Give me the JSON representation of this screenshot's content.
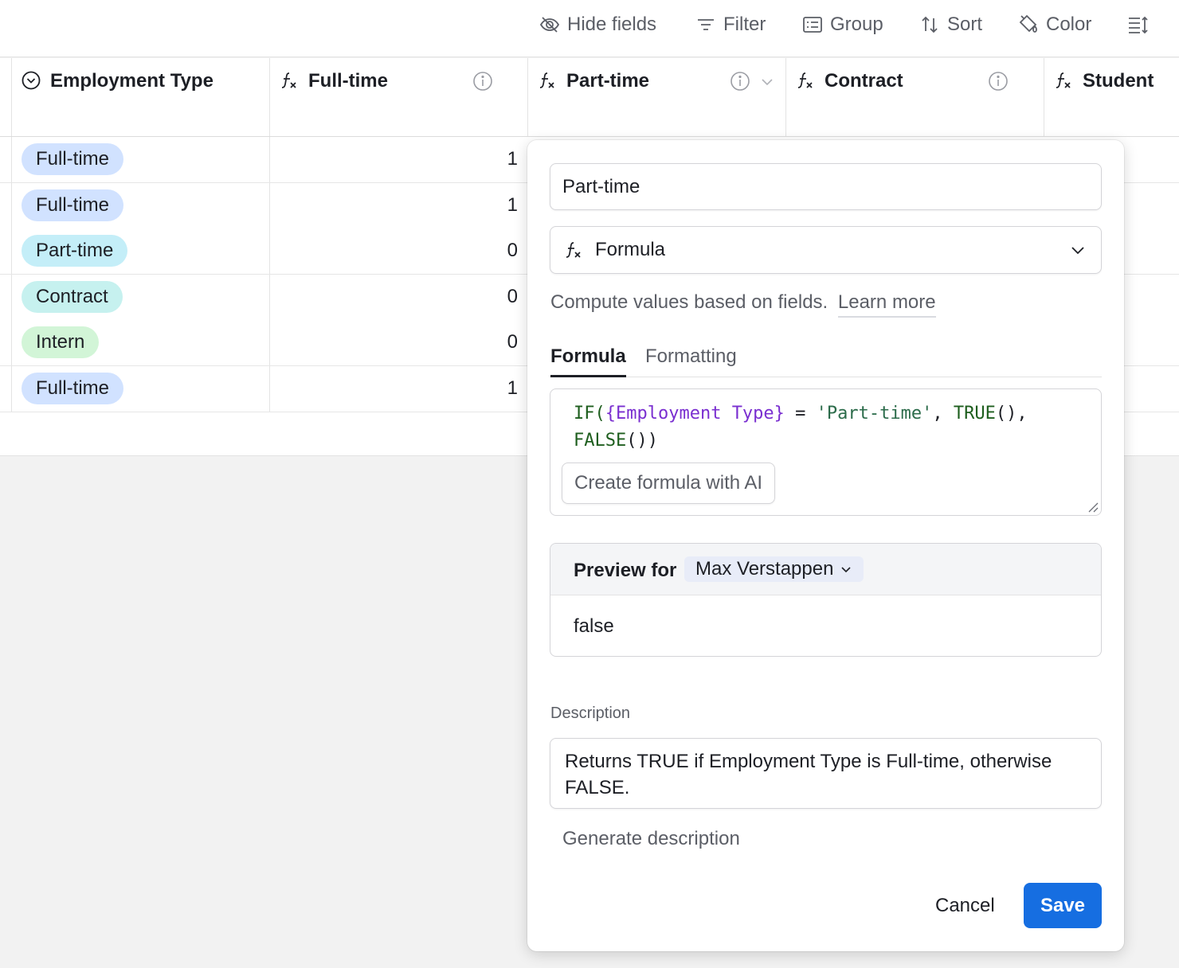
{
  "toolbar": {
    "hide_fields": "Hide fields",
    "filter": "Filter",
    "group": "Group",
    "sort": "Sort",
    "color": "Color"
  },
  "columns": [
    {
      "label": "Employment Type",
      "icon": "single-select-icon"
    },
    {
      "label": "Full-time",
      "icon": "formula-icon"
    },
    {
      "label": "Part-time",
      "icon": "formula-icon"
    },
    {
      "label": "Contract",
      "icon": "formula-icon"
    },
    {
      "label": "Student",
      "icon": "formula-icon"
    }
  ],
  "rows": [
    {
      "type": "Full-time",
      "full_time": "1",
      "color": "#d1e2ff"
    },
    {
      "type": "Full-time",
      "full_time": "1",
      "color": "#d1e2ff"
    },
    {
      "type": "Part-time",
      "full_time": "0",
      "color": "#c4eef8"
    },
    {
      "type": "Contract",
      "full_time": "0",
      "color": "#c6f1ef"
    },
    {
      "type": "Intern",
      "full_time": "0",
      "color": "#d2f5d7"
    },
    {
      "type": "Full-time",
      "full_time": "1",
      "color": "#d1e2ff"
    }
  ],
  "editor": {
    "field_name": "Part-time",
    "field_type": "Formula",
    "help_text": "Compute values based on fields.",
    "learn_more": "Learn more",
    "tabs": {
      "formula": "Formula",
      "formatting": "Formatting"
    },
    "formula": {
      "line1": {
        "fn": "IF(",
        "field": "{Employment Type}",
        "op": " = ",
        "str": "'Part-time'",
        "sep": ", ",
        "fn2": "TRUE",
        "close": "(),"
      },
      "line2": {
        "fn": "FALSE",
        "close": "())"
      }
    },
    "ai_button": "Create formula with AI",
    "preview_label": "Preview for",
    "preview_record": "Max Verstappen",
    "preview_value": "false",
    "description_label": "Description",
    "description": "Returns TRUE if Employment Type is Full-time, otherwise FALSE.",
    "generate_description": "Generate description",
    "cancel": "Cancel",
    "save": "Save"
  },
  "colors": {
    "accent": "#166ee1",
    "formula_fn": "#1e5e1e",
    "formula_field": "#7a2fd0",
    "formula_string": "#2b6b4a"
  }
}
